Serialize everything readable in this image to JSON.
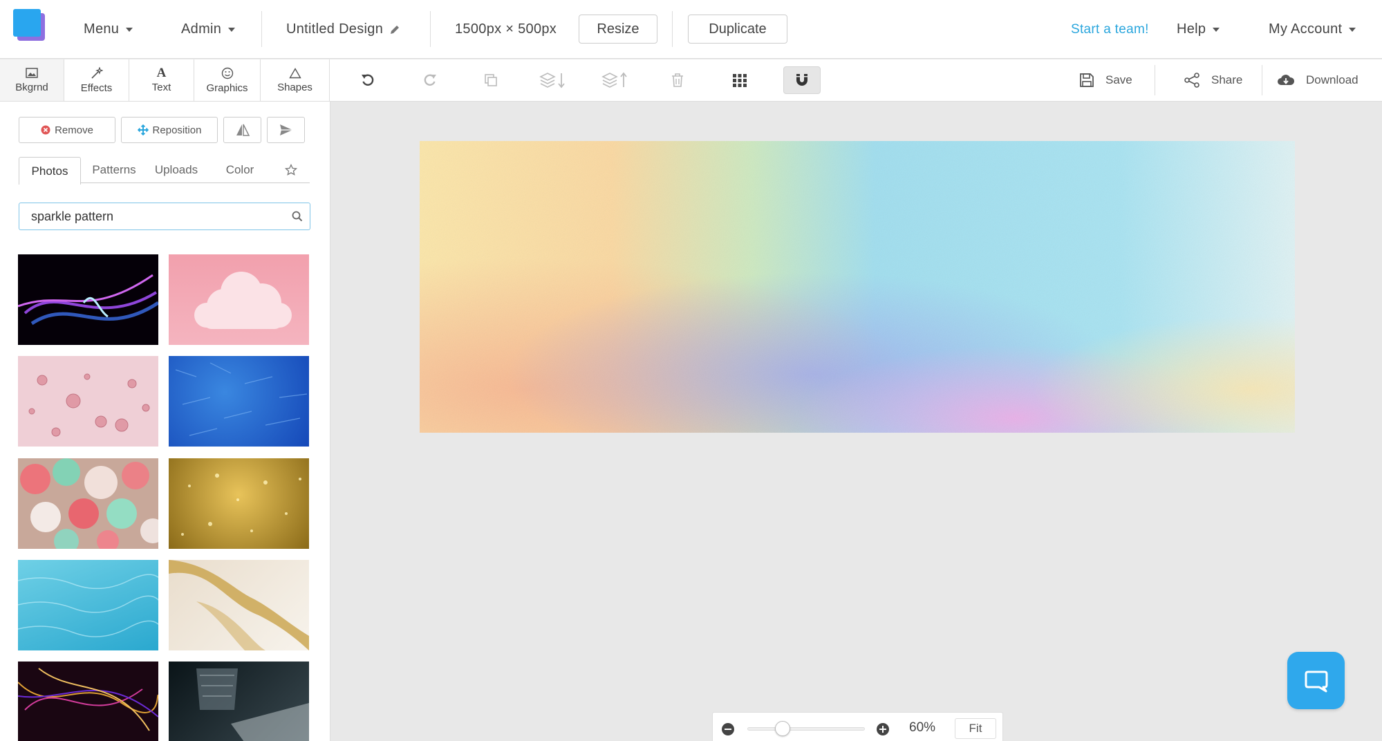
{
  "topbar": {
    "menu": "Menu",
    "admin": "Admin",
    "design_title": "Untitled Design",
    "dimensions": "1500px × 500px",
    "resize": "Resize",
    "duplicate": "Duplicate",
    "team": "Start a team!",
    "help": "Help",
    "account": "My Account",
    "team_color": "#2aa6dd"
  },
  "left_tabs": [
    {
      "label": "Bkgrnd",
      "icon": "background-icon",
      "active": true
    },
    {
      "label": "Effects",
      "icon": "wand-icon"
    },
    {
      "label": "Text",
      "icon": "text-icon"
    },
    {
      "label": "Graphics",
      "icon": "smiley-icon"
    },
    {
      "label": "Shapes",
      "icon": "triangle-icon"
    }
  ],
  "toolbar": {
    "icons": [
      "undo-icon",
      "redo-icon",
      "copy-icon",
      "layer-down-icon",
      "layer-up-icon",
      "trash-icon",
      "grid-icon",
      "magnet-icon"
    ],
    "active": "magnet-icon",
    "save": "Save",
    "share": "Share",
    "download": "Download"
  },
  "panel": {
    "remove": "Remove",
    "reposition": "Reposition",
    "flip": "flip-icon",
    "send": "send-icon",
    "tabs": [
      "Photos",
      "Patterns",
      "Uploads",
      "Color"
    ],
    "active_tab": "Photos",
    "favorites": "star-icon",
    "search_value": "sparkle pattern",
    "search_icon": "search-icon",
    "thumbnails": [
      "neon-light-streaks",
      "pink-cloud",
      "pink-water-droplets",
      "blue-glitter",
      "pastel-bokeh",
      "gold-glitter",
      "blue-pool-water",
      "gold-marble",
      "neon-light-trails",
      "crystal-glass"
    ]
  },
  "zoom": {
    "value": "60%",
    "fit": "Fit",
    "slider_level": 0.3
  },
  "colors": {
    "brand_blue": "#29a6ef",
    "brand_purple": "#8e6fe0",
    "chat_blue": "#2fa8ec"
  }
}
